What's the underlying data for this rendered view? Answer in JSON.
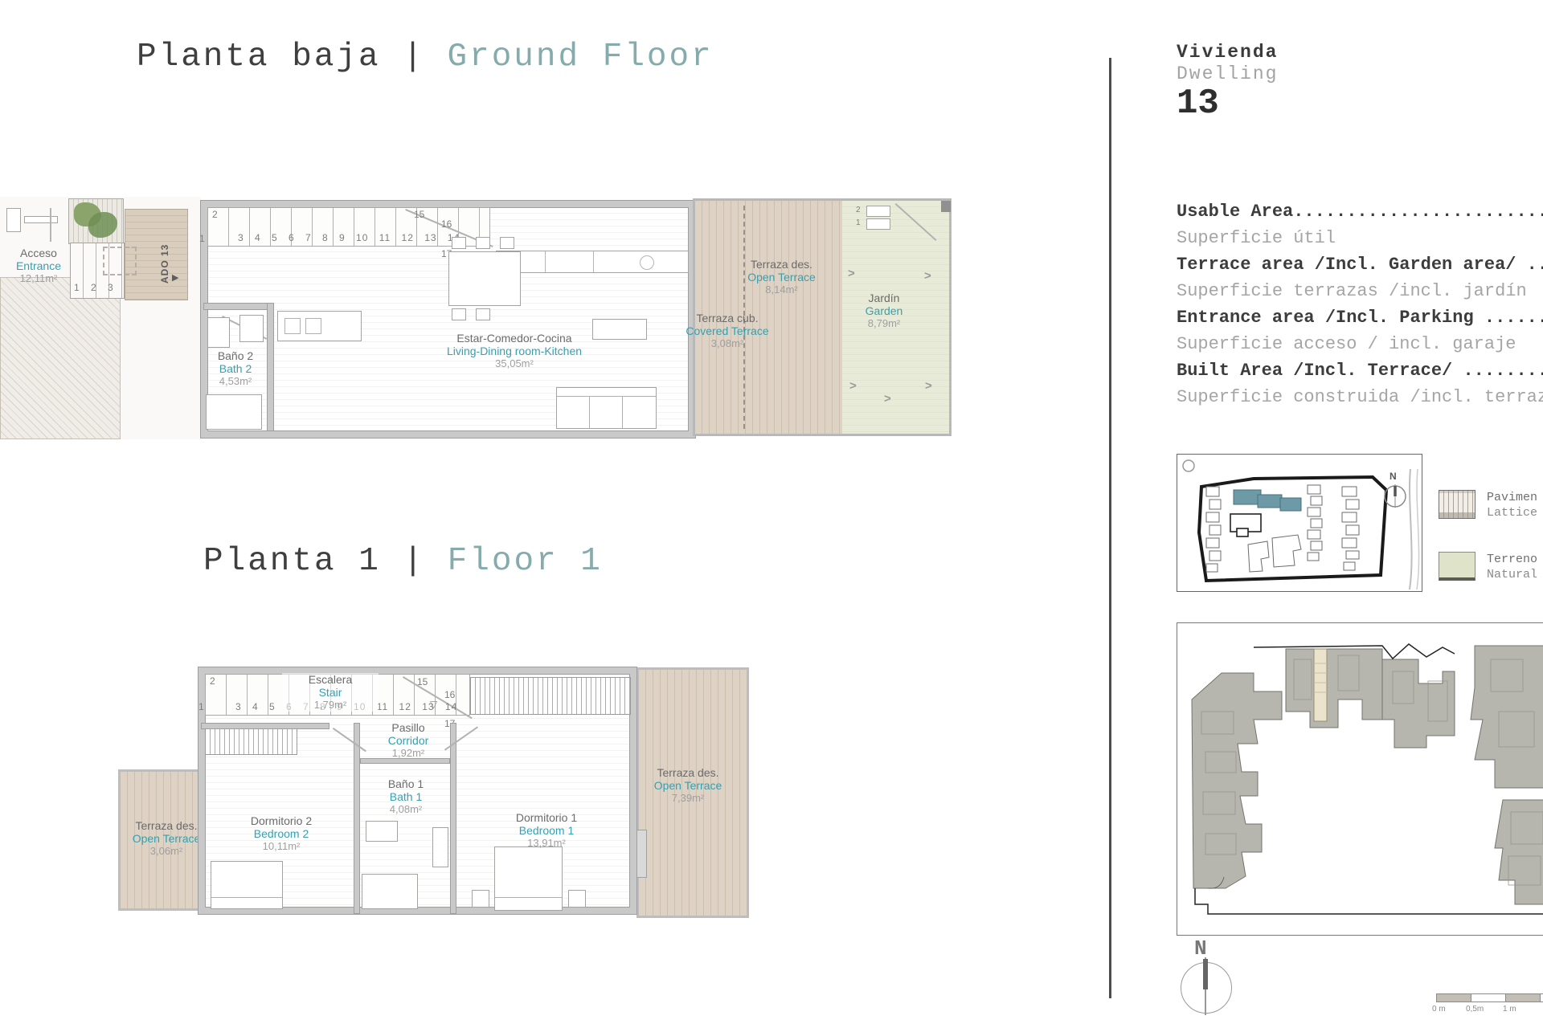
{
  "titles": {
    "ground": {
      "es": "Planta baja",
      "sep": "|",
      "en": "Ground Floor"
    },
    "floor1": {
      "es": "Planta 1",
      "sep": "|",
      "en": "Floor 1"
    }
  },
  "ground_floor": {
    "entrance": {
      "es": "Acceso",
      "en": "Entrance",
      "area": "12,11m²"
    },
    "entry_steps": "1 2 3 4",
    "ramp": {
      "label": "ADO 13",
      "arrow": "▶"
    },
    "stairs": {
      "n1": "1",
      "n2": "2",
      "run": "3 4 5 6 7 8 9 10 11 12 13 14",
      "n15": "15",
      "n16": "16",
      "n17": "17"
    },
    "bath2": {
      "es": "Baño 2",
      "en": "Bath 2",
      "area": "4,53m²"
    },
    "living": {
      "es": "Estar-Comedor-Cocina",
      "en": "Living-Dining room-Kitchen",
      "area": "35,05m²"
    },
    "open_terrace": {
      "es": "Terraza des.",
      "en": "Open Terrace",
      "area": "8,14m²"
    },
    "covered_terrace": {
      "es": "Terraza cub.",
      "en": "Covered Terrace",
      "area": "3,08m²"
    },
    "garden": {
      "es": "Jardín",
      "en": "Garden",
      "area": "8,79m²",
      "arrow": ">",
      "step1": "2",
      "step2": "1"
    }
  },
  "floor1": {
    "stair": {
      "es": "Escalera",
      "en": "Stair",
      "area": "1,79m²"
    },
    "stairs": {
      "n1": "1",
      "n2": "2",
      "run": "3 4 5 6 7 8 9 10 11 12 13 14",
      "n15": "15",
      "n16": "16",
      "n17": "17",
      "up": "▽"
    },
    "corridor": {
      "es": "Pasillo",
      "en": "Corridor",
      "area": "1,92m²"
    },
    "bedroom2": {
      "es": "Dormitorio 2",
      "en": "Bedroom 2",
      "area": "10,11m²"
    },
    "bath1": {
      "es": "Baño 1",
      "en": "Bath 1",
      "area": "4,08m²"
    },
    "bedroom1": {
      "es": "Dormitorio 1",
      "en": "Bedroom 1",
      "area": "13,91m²"
    },
    "terrace_left": {
      "es": "Terraza des.",
      "en": "Open Terrace",
      "area": "3,06m²"
    },
    "terrace_right": {
      "es": "Terraza des.",
      "en": "Open Terrace",
      "area": "7,39m²"
    }
  },
  "panel": {
    "dwelling_es": "Vivienda",
    "dwelling_en": "Dwelling",
    "dwelling_number": "13",
    "areas": [
      {
        "en": "Usable Area....................................",
        "es": "Superficie útil"
      },
      {
        "en": "Terrace area /Incl. Garden area/ ...",
        "es": "Superficie terrazas /incl. jardín"
      },
      {
        "en": "Entrance area /Incl. Parking ......",
        "es": "Superficie acceso / incl. garaje"
      },
      {
        "en": "Built Area /Incl. Terrace/ ........",
        "es": "Superficie construida /incl. terraza"
      }
    ],
    "legend": [
      {
        "line1": "Pavimen",
        "line2": "Lattice"
      },
      {
        "line1": "Terreno",
        "line2": "Natural"
      }
    ],
    "minimap_compass": "N",
    "compass": "N",
    "scale": {
      "l0": "0 m",
      "l05": "0,5m",
      "l1": "1 m"
    }
  },
  "colors": {
    "accent_teal": "#36a0b0",
    "title_teal": "#85abad",
    "terrace_beige": "#ddd2c4",
    "garden_green": "#e7ebd7",
    "highlight_cream": "#ebe3cb",
    "building_gray": "#b6b6af",
    "minimap_teal": "#6d9aa6"
  }
}
